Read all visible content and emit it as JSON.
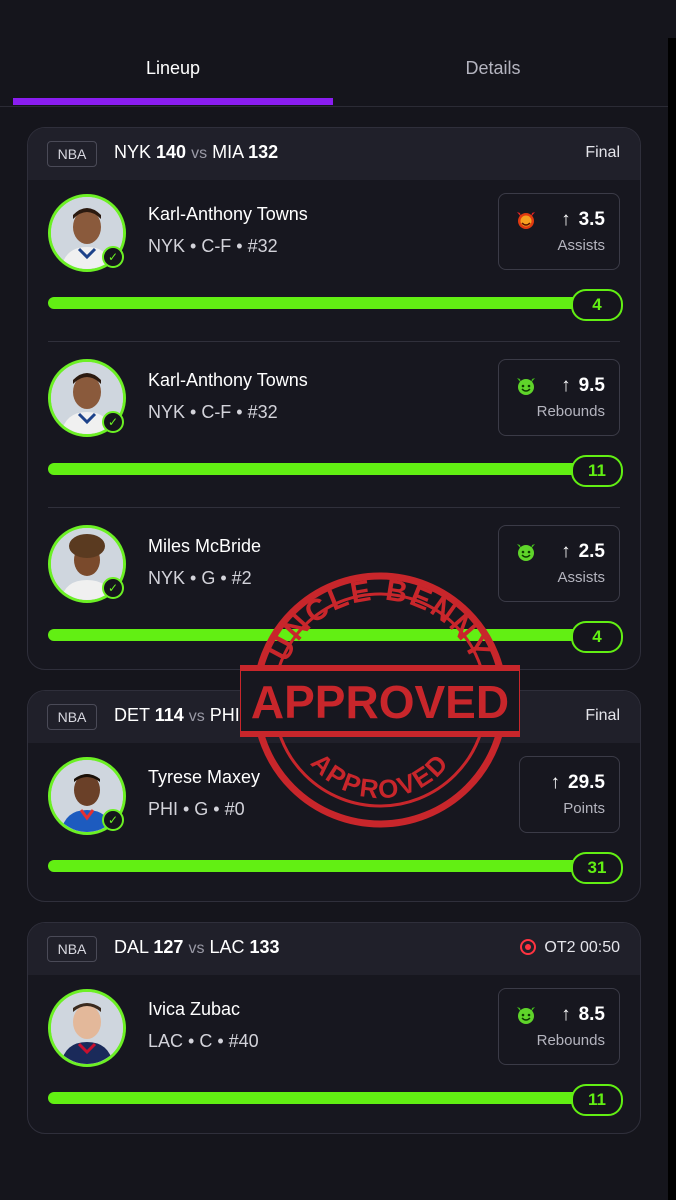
{
  "tabs": {
    "lineup": "Lineup",
    "details": "Details"
  },
  "games": [
    {
      "league": "NBA",
      "team1": "NYK",
      "score1": "140",
      "vs": "vs",
      "team2": "MIA",
      "score2": "132",
      "status": "Final",
      "picks": [
        {
          "name": "Karl-Anthony Towns",
          "info": "NYK • C-F • #32",
          "line": "3.5",
          "stat": "Assists",
          "result": "4",
          "emoji": "devil-red-icon"
        },
        {
          "name": "Karl-Anthony Towns",
          "info": "NYK • C-F • #32",
          "line": "9.5",
          "stat": "Rebounds",
          "result": "11",
          "emoji": "devil-green-icon"
        },
        {
          "name": "Miles McBride",
          "info": "NYK • G • #2",
          "line": "2.5",
          "stat": "Assists",
          "result": "4",
          "emoji": "devil-green-icon"
        }
      ]
    },
    {
      "league": "NBA",
      "team1": "DET",
      "score1": "114",
      "vs": "vs",
      "team2": "PHI",
      "score2": "1",
      "status": "Final",
      "picks": [
        {
          "name": "Tyrese Maxey",
          "info": "PHI • G • #0",
          "line": "29.5",
          "stat": "Points",
          "result": "31",
          "emoji": ""
        }
      ]
    },
    {
      "league": "NBA",
      "team1": "DAL",
      "score1": "127",
      "vs": "vs",
      "team2": "LAC",
      "score2": "133",
      "status": "OT2 00:50",
      "picks": [
        {
          "name": "Ivica Zubac",
          "info": "LAC • C • #40",
          "line": "8.5",
          "stat": "Rebounds",
          "result": "11",
          "emoji": "devil-green-icon"
        }
      ]
    }
  ],
  "stamp": {
    "top": "UNCLE BENNY",
    "middle": "APPROVED",
    "bottom": "APPROVED"
  },
  "colors": {
    "accent": "#8a1df0",
    "progress": "#62ef13",
    "live": "#ff3340",
    "stamp": "#c8262b"
  }
}
